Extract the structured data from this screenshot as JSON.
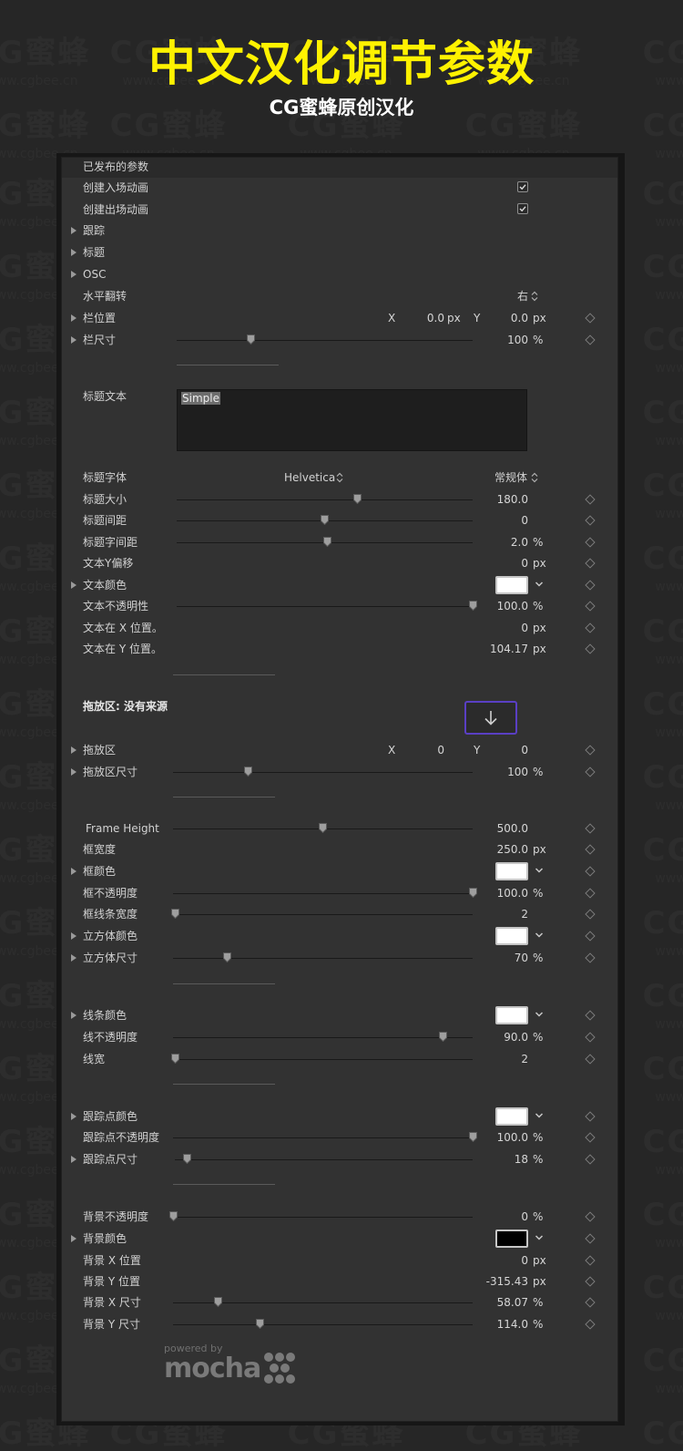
{
  "header": {
    "title": "中文汉化调节参数",
    "subtitle": "CG蜜蜂原创汉化"
  },
  "watermark": {
    "brand": "CG蜜蜂",
    "url": "www.cgbee.cn"
  },
  "colors": {
    "title_yellow": "#fff200",
    "panel_bg": "#323232",
    "drop_accent": "#5a3fc4",
    "swatch_white": "#ffffff",
    "swatch_black": "#000000"
  },
  "panel": {
    "section_title": "已发布的参数",
    "create_in_anim": {
      "label": "创建入场动画",
      "checked": true
    },
    "create_out_anim": {
      "label": "创建出场动画",
      "checked": true
    },
    "tracking": "跟踪",
    "title_group": "标题",
    "osc": "OSC",
    "flip": {
      "label": "水平翻转",
      "value": "右"
    },
    "bar_position": {
      "label": "栏位置",
      "x_label": "X",
      "x_value": "0.0",
      "x_unit": "px",
      "y_label": "Y",
      "y_value": "0.0",
      "y_unit": "px"
    },
    "bar_size": {
      "label": "栏尺寸",
      "value": "100",
      "unit": "%",
      "slider": 0.25
    },
    "title_text": {
      "label": "标题文本",
      "value": "Simple"
    },
    "title_font": {
      "label": "标题字体",
      "family": "Helvetica",
      "style": "常规体"
    },
    "title_size": {
      "label": "标题大小",
      "value": "180.0",
      "slider": 0.61
    },
    "title_spacing": {
      "label": "标题间距",
      "value": "0",
      "slider": 0.5
    },
    "title_tracking": {
      "label": "标题字间距",
      "value": "2.0",
      "unit": "%",
      "slider": 0.51
    },
    "text_y_offset": {
      "label": "文本Y偏移",
      "value": "0",
      "unit": "px"
    },
    "text_color": {
      "label": "文本颜色"
    },
    "text_opacity": {
      "label": "文本不透明性",
      "value": "100.0",
      "unit": "%",
      "slider": 1.0
    },
    "text_x_pos": {
      "label": "文本在 X 位置。",
      "value": "0",
      "unit": "px"
    },
    "text_y_pos": {
      "label": "文本在 Y 位置。",
      "value": "104.17",
      "unit": "px"
    },
    "drop_zone_header": "拖放区: 没有来源",
    "drop_zone": {
      "label": "拖放区",
      "x_label": "X",
      "x_value": "0",
      "y_label": "Y",
      "y_value": "0"
    },
    "drop_zone_size": {
      "label": "拖放区尺寸",
      "value": "100",
      "unit": "%",
      "slider": 0.25
    },
    "frame_height": {
      "label": "Frame Height",
      "value": "500.0",
      "slider": 0.5
    },
    "frame_width": {
      "label": "框宽度",
      "value": "250.0",
      "unit": "px"
    },
    "frame_color": {
      "label": "框颜色"
    },
    "frame_opacity": {
      "label": "框不透明度",
      "value": "100.0",
      "unit": "%",
      "slider": 1.0
    },
    "frame_line_width": {
      "label": "框线条宽度",
      "value": "2",
      "slider": 0.0
    },
    "cube_color": {
      "label": "立方体颜色"
    },
    "cube_size": {
      "label": "立方体尺寸",
      "value": "70",
      "unit": "%",
      "slider": 0.18
    },
    "line_color": {
      "label": "线条颜色"
    },
    "line_opacity": {
      "label": "线不透明度",
      "value": "90.0",
      "unit": "%",
      "slider": 0.9
    },
    "line_width": {
      "label": "线宽",
      "value": "2",
      "slider": 0.0
    },
    "track_point_color": {
      "label": "跟踪点颜色"
    },
    "track_point_opacity": {
      "label": "跟踪点不透明度",
      "value": "100.0",
      "unit": "%",
      "slider": 1.0
    },
    "track_point_size": {
      "label": "跟踪点尺寸",
      "value": "18",
      "unit": "%",
      "slider": 0.04
    },
    "bg_opacity": {
      "label": "背景不透明度",
      "value": "0",
      "unit": "%",
      "slider": 0.0
    },
    "bg_color": {
      "label": "背景颜色"
    },
    "bg_x_pos": {
      "label": "背景 X 位置",
      "value": "0",
      "unit": "px"
    },
    "bg_y_pos": {
      "label": "背景 Y 位置",
      "value": "-315.43",
      "unit": "px"
    },
    "bg_x_size": {
      "label": "背景 X 尺寸",
      "value": "58.07",
      "unit": "%",
      "slider": 0.15
    },
    "bg_y_size": {
      "label": "背景 Y 尺寸",
      "value": "114.0",
      "unit": "%",
      "slider": 0.29
    }
  },
  "branding": {
    "powered_by": "powered by",
    "name": "mocha"
  }
}
